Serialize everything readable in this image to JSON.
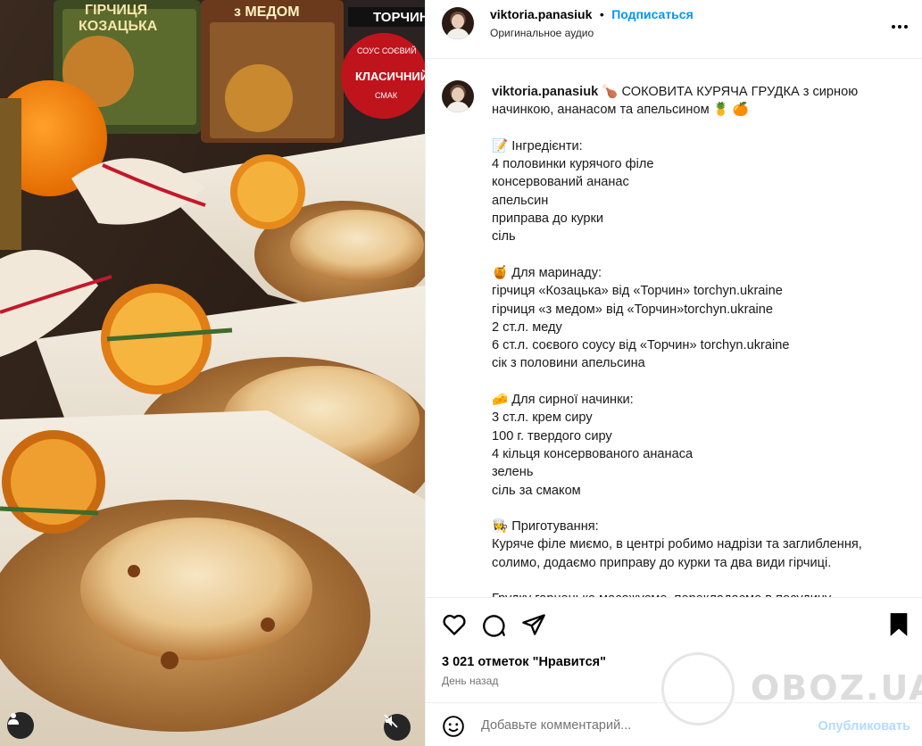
{
  "post": {
    "username": "viktoria.panasiuk",
    "separator": "•",
    "follow_label": "Подписаться",
    "audio_label": "Оригинальное аудио",
    "more_label": "•••"
  },
  "photo": {
    "pack_texts": [
      "ГІРЧИЦЯ",
      "КОЗАЦЬКА",
      "з МЕДОМ",
      "ТОРЧИН",
      "СОУС СОЄВИЙ",
      "КЛАСИЧНИЙ",
      "СМАК"
    ]
  },
  "caption": {
    "username": "viktoria.panasiuk",
    "lines": [
      "🍗 СОКОВИТА КУРЯЧА ГРУДКА з сирною",
      "начинкою, ананасом та апельсином 🍍 🍊",
      "",
      "📝 Інгредієнти:",
      "4 половинки курячого філе",
      "консервований ананас",
      "апельсин",
      "приправа до курки",
      "сіль",
      "",
      "🍯 Для маринаду:",
      "гірчиця «Козацька» від «Торчин» torchyn.ukraine",
      "гірчиця «з медом» від «Торчин»torchyn.ukraine",
      "2 ст.л. меду",
      "6 ст.л. соєвого соусу від «Торчин» torchyn.ukraine",
      "сік з половини апельсина",
      "",
      "🧀 Для сирної начинки:",
      "3 ст.л. крем сиру",
      "100 г. твердого сиру",
      "4 кільця консервованого ананаса",
      "зелень",
      "сіль за смаком",
      "",
      "👩‍🍳 Приготування:",
      "Куряче філе миємо, в центрі робимо надрізи та заглиблення,",
      "солимо, додаємо приправу до курки та два види гірчиці.",
      "",
      "Грудку гарненько масажуємо, перекладаємо в посудину"
    ]
  },
  "stats": {
    "likes": "3 021 отметок \"Нравится\"",
    "time": "День назад"
  },
  "comment": {
    "placeholder": "Добавьте комментарий...",
    "publish_label": "Опубликовать"
  },
  "watermark": {
    "text": "OBOZ.UA"
  },
  "colors": {
    "accent": "#0095f6",
    "publish_disabled": "#b3dbff",
    "muted": "#737373"
  }
}
